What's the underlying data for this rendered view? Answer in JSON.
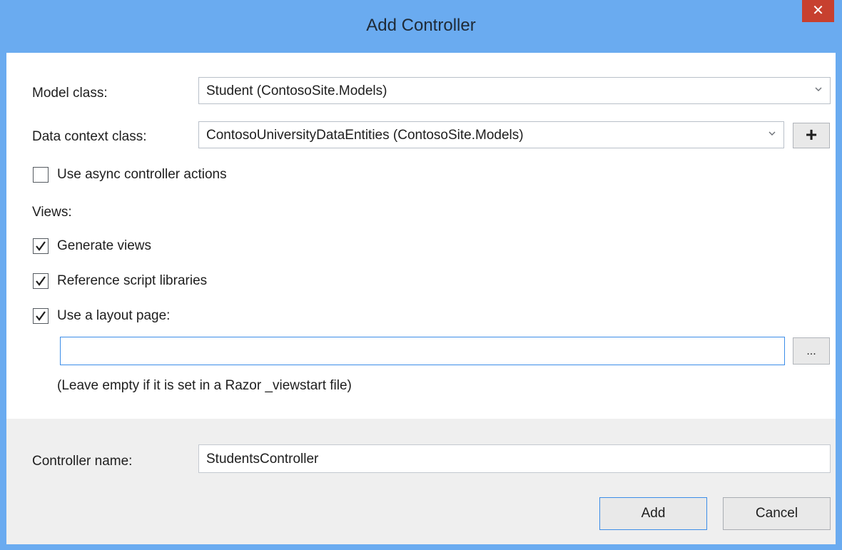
{
  "window": {
    "title": "Add Controller",
    "close_glyph": "✕"
  },
  "form": {
    "model_class": {
      "label": "Model class:",
      "value": "Student (ContosoSite.Models)"
    },
    "data_context_class": {
      "label": "Data context class:",
      "value": "ContosoUniversityDataEntities (ContosoSite.Models)",
      "add_button_label": "+"
    },
    "async_actions": {
      "label": "Use async controller actions",
      "checked": false
    },
    "views_heading": "Views:",
    "generate_views": {
      "label": "Generate views",
      "checked": true
    },
    "reference_scripts": {
      "label": "Reference script libraries",
      "checked": true
    },
    "use_layout": {
      "label": "Use a layout page:",
      "checked": true
    },
    "layout_path": {
      "value": "",
      "browse_label": "..."
    },
    "layout_hint": "(Leave empty if it is set in a Razor _viewstart file)"
  },
  "footer": {
    "controller_name_label": "Controller name:",
    "controller_name_value": "StudentsController",
    "add_label": "Add",
    "cancel_label": "Cancel"
  },
  "colors": {
    "titlebar": "#6aabf0",
    "close": "#c7402f",
    "focus_border": "#3c8de8"
  }
}
